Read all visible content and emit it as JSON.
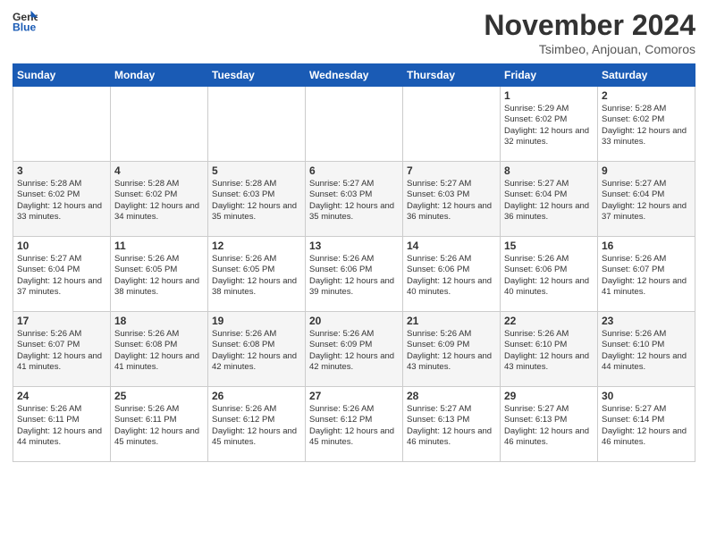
{
  "logo": {
    "line1": "General",
    "line2": "Blue"
  },
  "title": "November 2024",
  "location": "Tsimbeo, Anjouan, Comoros",
  "weekdays": [
    "Sunday",
    "Monday",
    "Tuesday",
    "Wednesday",
    "Thursday",
    "Friday",
    "Saturday"
  ],
  "weeks": [
    [
      {
        "day": "",
        "info": ""
      },
      {
        "day": "",
        "info": ""
      },
      {
        "day": "",
        "info": ""
      },
      {
        "day": "",
        "info": ""
      },
      {
        "day": "",
        "info": ""
      },
      {
        "day": "1",
        "info": "Sunrise: 5:29 AM\nSunset: 6:02 PM\nDaylight: 12 hours and 32 minutes."
      },
      {
        "day": "2",
        "info": "Sunrise: 5:28 AM\nSunset: 6:02 PM\nDaylight: 12 hours and 33 minutes."
      }
    ],
    [
      {
        "day": "3",
        "info": "Sunrise: 5:28 AM\nSunset: 6:02 PM\nDaylight: 12 hours and 33 minutes."
      },
      {
        "day": "4",
        "info": "Sunrise: 5:28 AM\nSunset: 6:02 PM\nDaylight: 12 hours and 34 minutes."
      },
      {
        "day": "5",
        "info": "Sunrise: 5:28 AM\nSunset: 6:03 PM\nDaylight: 12 hours and 35 minutes."
      },
      {
        "day": "6",
        "info": "Sunrise: 5:27 AM\nSunset: 6:03 PM\nDaylight: 12 hours and 35 minutes."
      },
      {
        "day": "7",
        "info": "Sunrise: 5:27 AM\nSunset: 6:03 PM\nDaylight: 12 hours and 36 minutes."
      },
      {
        "day": "8",
        "info": "Sunrise: 5:27 AM\nSunset: 6:04 PM\nDaylight: 12 hours and 36 minutes."
      },
      {
        "day": "9",
        "info": "Sunrise: 5:27 AM\nSunset: 6:04 PM\nDaylight: 12 hours and 37 minutes."
      }
    ],
    [
      {
        "day": "10",
        "info": "Sunrise: 5:27 AM\nSunset: 6:04 PM\nDaylight: 12 hours and 37 minutes."
      },
      {
        "day": "11",
        "info": "Sunrise: 5:26 AM\nSunset: 6:05 PM\nDaylight: 12 hours and 38 minutes."
      },
      {
        "day": "12",
        "info": "Sunrise: 5:26 AM\nSunset: 6:05 PM\nDaylight: 12 hours and 38 minutes."
      },
      {
        "day": "13",
        "info": "Sunrise: 5:26 AM\nSunset: 6:06 PM\nDaylight: 12 hours and 39 minutes."
      },
      {
        "day": "14",
        "info": "Sunrise: 5:26 AM\nSunset: 6:06 PM\nDaylight: 12 hours and 40 minutes."
      },
      {
        "day": "15",
        "info": "Sunrise: 5:26 AM\nSunset: 6:06 PM\nDaylight: 12 hours and 40 minutes."
      },
      {
        "day": "16",
        "info": "Sunrise: 5:26 AM\nSunset: 6:07 PM\nDaylight: 12 hours and 41 minutes."
      }
    ],
    [
      {
        "day": "17",
        "info": "Sunrise: 5:26 AM\nSunset: 6:07 PM\nDaylight: 12 hours and 41 minutes."
      },
      {
        "day": "18",
        "info": "Sunrise: 5:26 AM\nSunset: 6:08 PM\nDaylight: 12 hours and 41 minutes."
      },
      {
        "day": "19",
        "info": "Sunrise: 5:26 AM\nSunset: 6:08 PM\nDaylight: 12 hours and 42 minutes."
      },
      {
        "day": "20",
        "info": "Sunrise: 5:26 AM\nSunset: 6:09 PM\nDaylight: 12 hours and 42 minutes."
      },
      {
        "day": "21",
        "info": "Sunrise: 5:26 AM\nSunset: 6:09 PM\nDaylight: 12 hours and 43 minutes."
      },
      {
        "day": "22",
        "info": "Sunrise: 5:26 AM\nSunset: 6:10 PM\nDaylight: 12 hours and 43 minutes."
      },
      {
        "day": "23",
        "info": "Sunrise: 5:26 AM\nSunset: 6:10 PM\nDaylight: 12 hours and 44 minutes."
      }
    ],
    [
      {
        "day": "24",
        "info": "Sunrise: 5:26 AM\nSunset: 6:11 PM\nDaylight: 12 hours and 44 minutes."
      },
      {
        "day": "25",
        "info": "Sunrise: 5:26 AM\nSunset: 6:11 PM\nDaylight: 12 hours and 45 minutes."
      },
      {
        "day": "26",
        "info": "Sunrise: 5:26 AM\nSunset: 6:12 PM\nDaylight: 12 hours and 45 minutes."
      },
      {
        "day": "27",
        "info": "Sunrise: 5:26 AM\nSunset: 6:12 PM\nDaylight: 12 hours and 45 minutes."
      },
      {
        "day": "28",
        "info": "Sunrise: 5:27 AM\nSunset: 6:13 PM\nDaylight: 12 hours and 46 minutes."
      },
      {
        "day": "29",
        "info": "Sunrise: 5:27 AM\nSunset: 6:13 PM\nDaylight: 12 hours and 46 minutes."
      },
      {
        "day": "30",
        "info": "Sunrise: 5:27 AM\nSunset: 6:14 PM\nDaylight: 12 hours and 46 minutes."
      }
    ]
  ]
}
